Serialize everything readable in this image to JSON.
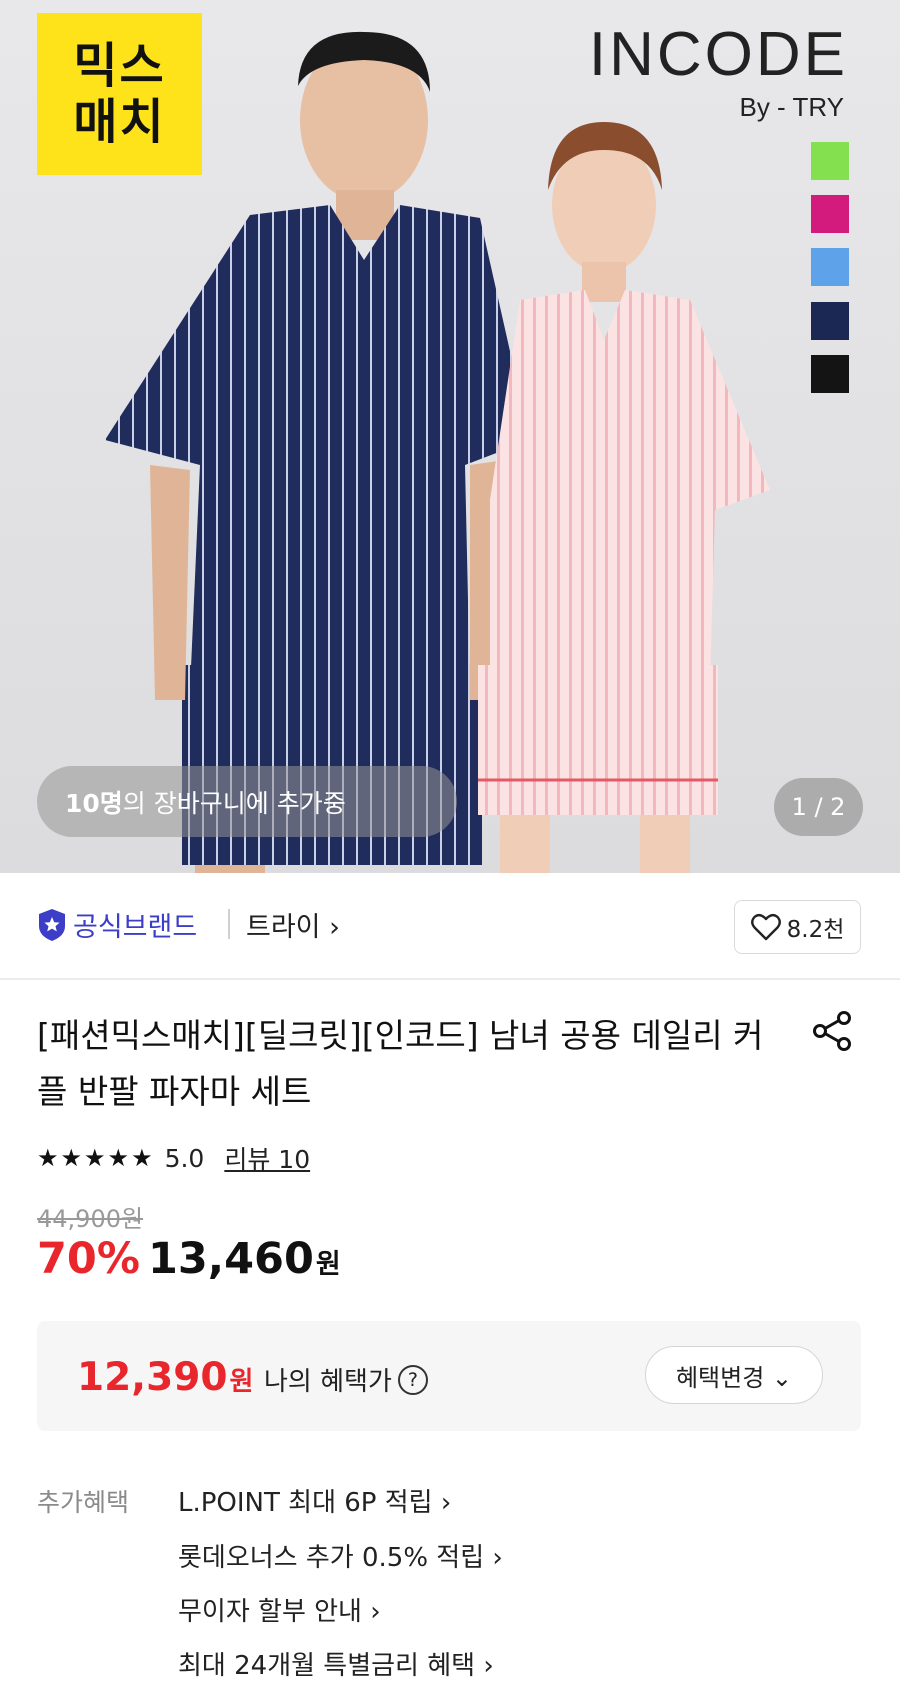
{
  "hero": {
    "badge_line1": "믹스",
    "badge_line2": "매치",
    "brand_logo": "INCODE",
    "brand_logo_sub": "By - TRY",
    "swatch_colors": [
      "#85e04f",
      "#d21b7c",
      "#5ea3ea",
      "#1c2854",
      "#141414"
    ],
    "cart_count": "10명",
    "cart_text": "의 장바구니에 추가중",
    "page_indicator": "1 / 2"
  },
  "brand": {
    "official_label": "공식브랜드",
    "name": "트라이 ›",
    "like_count": "8.2천",
    "accent": "#3d3ec8"
  },
  "product": {
    "title": "[패션믹스매치][딜크릿][인코드] 남녀 공용 데일리 커플 반팔 파자마 세트",
    "stars": "★★★★★",
    "rating": "5.0",
    "review_link": "리뷰 10",
    "original_price": "44,900원",
    "discount_rate": "70%",
    "sale_price": "13,460",
    "sale_unit": "원"
  },
  "benefit": {
    "price": "12,390",
    "unit": "원",
    "label": "나의 혜택가",
    "help": "?",
    "change_button": "혜택변경 ⌄"
  },
  "extra": {
    "label": "추가혜택",
    "items": [
      "L.POINT 최대 6P 적립 ›",
      "롯데오너스 추가 0.5% 적립 ›",
      "무이자 할부 안내 ›",
      "최대 24개월 특별금리 혜택 ›"
    ]
  }
}
